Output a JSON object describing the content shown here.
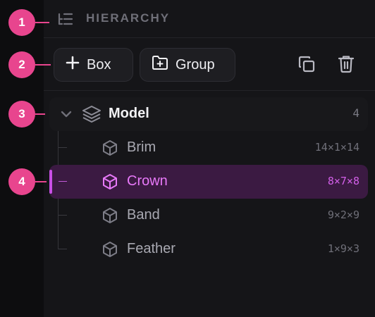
{
  "header": {
    "title": "HIERARCHY",
    "icon": "list-tree-icon"
  },
  "toolbar": {
    "box_label": "Box",
    "group_label": "Group",
    "duplicate_icon": "copy-icon",
    "delete_icon": "trash-icon"
  },
  "model": {
    "label": "Model",
    "count": "4",
    "icon": "layers-icon"
  },
  "items": [
    {
      "label": "Brim",
      "dims": "14×1×14",
      "selected": false
    },
    {
      "label": "Crown",
      "dims": "8×7×8",
      "selected": true
    },
    {
      "label": "Band",
      "dims": "9×2×9",
      "selected": false
    },
    {
      "label": "Feather",
      "dims": "1×9×3",
      "selected": false
    }
  ],
  "callouts": [
    "1",
    "2",
    "3",
    "4"
  ],
  "colors": {
    "accent": "#e879f9",
    "selection_bg": "#3b1a42",
    "callout": "#e8458e",
    "panel_bg": "#151518"
  }
}
